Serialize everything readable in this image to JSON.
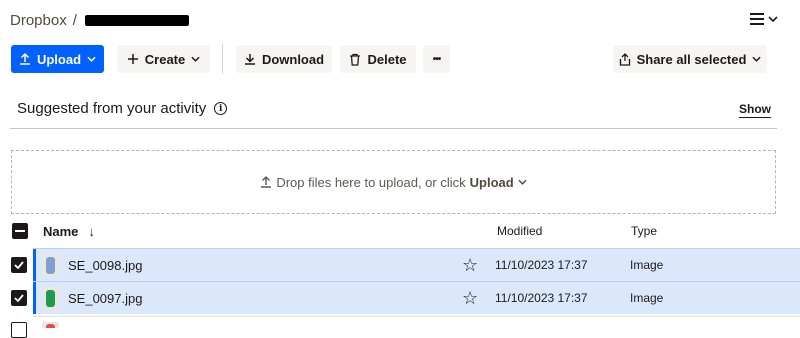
{
  "breadcrumb": {
    "root": "Dropbox",
    "separator": "/"
  },
  "toolbar": {
    "upload": "Upload",
    "create": "Create",
    "download": "Download",
    "delete": "Delete",
    "more": "•••",
    "share_all": "Share all selected"
  },
  "suggested": {
    "title": "Suggested from your activity",
    "info": "i",
    "show": "Show"
  },
  "dropzone": {
    "text": "Drop files here to upload, or click",
    "link": "Upload"
  },
  "table": {
    "headers": {
      "name": "Name",
      "sort": "↓",
      "modified": "Modified",
      "type": "Type"
    },
    "rows": [
      {
        "name": "SE_0098.jpg",
        "modified": "11/10/2023 17:37",
        "type": "Image",
        "selected": true,
        "thumb_color": "#7f9fd0"
      },
      {
        "name": "SE_0097.jpg",
        "modified": "11/10/2023 17:37",
        "type": "Image",
        "selected": true,
        "thumb_color": "#1f9b4c"
      }
    ]
  },
  "colors": {
    "accent": "#0061fe",
    "selected_row": "#dbe8fc",
    "secondary_button": "#f7f5f2"
  }
}
